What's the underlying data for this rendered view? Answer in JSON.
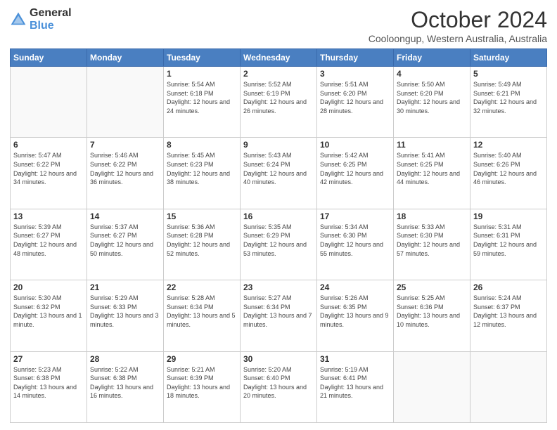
{
  "logo": {
    "general": "General",
    "blue": "Blue"
  },
  "header": {
    "month_year": "October 2024",
    "location": "Cooloongup, Western Australia, Australia"
  },
  "days_of_week": [
    "Sunday",
    "Monday",
    "Tuesday",
    "Wednesday",
    "Thursday",
    "Friday",
    "Saturday"
  ],
  "weeks": [
    [
      {
        "day": "",
        "info": ""
      },
      {
        "day": "",
        "info": ""
      },
      {
        "day": "1",
        "info": "Sunrise: 5:54 AM\nSunset: 6:18 PM\nDaylight: 12 hours and 24 minutes."
      },
      {
        "day": "2",
        "info": "Sunrise: 5:52 AM\nSunset: 6:19 PM\nDaylight: 12 hours and 26 minutes."
      },
      {
        "day": "3",
        "info": "Sunrise: 5:51 AM\nSunset: 6:20 PM\nDaylight: 12 hours and 28 minutes."
      },
      {
        "day": "4",
        "info": "Sunrise: 5:50 AM\nSunset: 6:20 PM\nDaylight: 12 hours and 30 minutes."
      },
      {
        "day": "5",
        "info": "Sunrise: 5:49 AM\nSunset: 6:21 PM\nDaylight: 12 hours and 32 minutes."
      }
    ],
    [
      {
        "day": "6",
        "info": "Sunrise: 5:47 AM\nSunset: 6:22 PM\nDaylight: 12 hours and 34 minutes."
      },
      {
        "day": "7",
        "info": "Sunrise: 5:46 AM\nSunset: 6:22 PM\nDaylight: 12 hours and 36 minutes."
      },
      {
        "day": "8",
        "info": "Sunrise: 5:45 AM\nSunset: 6:23 PM\nDaylight: 12 hours and 38 minutes."
      },
      {
        "day": "9",
        "info": "Sunrise: 5:43 AM\nSunset: 6:24 PM\nDaylight: 12 hours and 40 minutes."
      },
      {
        "day": "10",
        "info": "Sunrise: 5:42 AM\nSunset: 6:25 PM\nDaylight: 12 hours and 42 minutes."
      },
      {
        "day": "11",
        "info": "Sunrise: 5:41 AM\nSunset: 6:25 PM\nDaylight: 12 hours and 44 minutes."
      },
      {
        "day": "12",
        "info": "Sunrise: 5:40 AM\nSunset: 6:26 PM\nDaylight: 12 hours and 46 minutes."
      }
    ],
    [
      {
        "day": "13",
        "info": "Sunrise: 5:39 AM\nSunset: 6:27 PM\nDaylight: 12 hours and 48 minutes."
      },
      {
        "day": "14",
        "info": "Sunrise: 5:37 AM\nSunset: 6:27 PM\nDaylight: 12 hours and 50 minutes."
      },
      {
        "day": "15",
        "info": "Sunrise: 5:36 AM\nSunset: 6:28 PM\nDaylight: 12 hours and 52 minutes."
      },
      {
        "day": "16",
        "info": "Sunrise: 5:35 AM\nSunset: 6:29 PM\nDaylight: 12 hours and 53 minutes."
      },
      {
        "day": "17",
        "info": "Sunrise: 5:34 AM\nSunset: 6:30 PM\nDaylight: 12 hours and 55 minutes."
      },
      {
        "day": "18",
        "info": "Sunrise: 5:33 AM\nSunset: 6:30 PM\nDaylight: 12 hours and 57 minutes."
      },
      {
        "day": "19",
        "info": "Sunrise: 5:31 AM\nSunset: 6:31 PM\nDaylight: 12 hours and 59 minutes."
      }
    ],
    [
      {
        "day": "20",
        "info": "Sunrise: 5:30 AM\nSunset: 6:32 PM\nDaylight: 13 hours and 1 minute."
      },
      {
        "day": "21",
        "info": "Sunrise: 5:29 AM\nSunset: 6:33 PM\nDaylight: 13 hours and 3 minutes."
      },
      {
        "day": "22",
        "info": "Sunrise: 5:28 AM\nSunset: 6:34 PM\nDaylight: 13 hours and 5 minutes."
      },
      {
        "day": "23",
        "info": "Sunrise: 5:27 AM\nSunset: 6:34 PM\nDaylight: 13 hours and 7 minutes."
      },
      {
        "day": "24",
        "info": "Sunrise: 5:26 AM\nSunset: 6:35 PM\nDaylight: 13 hours and 9 minutes."
      },
      {
        "day": "25",
        "info": "Sunrise: 5:25 AM\nSunset: 6:36 PM\nDaylight: 13 hours and 10 minutes."
      },
      {
        "day": "26",
        "info": "Sunrise: 5:24 AM\nSunset: 6:37 PM\nDaylight: 13 hours and 12 minutes."
      }
    ],
    [
      {
        "day": "27",
        "info": "Sunrise: 5:23 AM\nSunset: 6:38 PM\nDaylight: 13 hours and 14 minutes."
      },
      {
        "day": "28",
        "info": "Sunrise: 5:22 AM\nSunset: 6:38 PM\nDaylight: 13 hours and 16 minutes."
      },
      {
        "day": "29",
        "info": "Sunrise: 5:21 AM\nSunset: 6:39 PM\nDaylight: 13 hours and 18 minutes."
      },
      {
        "day": "30",
        "info": "Sunrise: 5:20 AM\nSunset: 6:40 PM\nDaylight: 13 hours and 20 minutes."
      },
      {
        "day": "31",
        "info": "Sunrise: 5:19 AM\nSunset: 6:41 PM\nDaylight: 13 hours and 21 minutes."
      },
      {
        "day": "",
        "info": ""
      },
      {
        "day": "",
        "info": ""
      }
    ]
  ]
}
